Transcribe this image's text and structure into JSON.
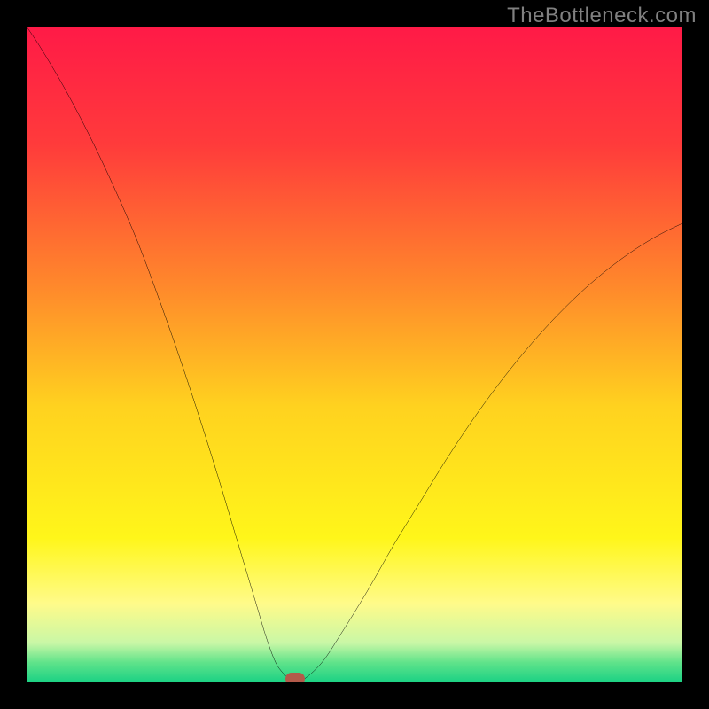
{
  "watermark": "TheBottleneck.com",
  "chart_data": {
    "type": "line",
    "title": "",
    "xlabel": "",
    "ylabel": "",
    "xlim": [
      0,
      100
    ],
    "ylim": [
      0,
      100
    ],
    "x": [
      0,
      2,
      5,
      8,
      11,
      14,
      17,
      20,
      23,
      26,
      29,
      32,
      35,
      36.5,
      38,
      39.5,
      40.5,
      42,
      45,
      48,
      52,
      56,
      60,
      64,
      68,
      72,
      76,
      80,
      84,
      88,
      92,
      96,
      100
    ],
    "values": [
      100,
      97,
      92,
      86.5,
      80.5,
      74,
      67,
      59,
      50.5,
      41.5,
      32,
      22,
      12,
      7,
      3,
      1,
      0.3,
      0.3,
      3,
      7.5,
      14,
      21,
      27.5,
      34,
      40,
      45.5,
      50.5,
      55,
      59,
      62.5,
      65.5,
      68,
      70
    ],
    "marker": {
      "x": 41,
      "y": 0.5
    },
    "background_gradient_stops": [
      {
        "offset": 0.0,
        "color": "#ff1a47"
      },
      {
        "offset": 0.18,
        "color": "#ff3b3b"
      },
      {
        "offset": 0.4,
        "color": "#ff8a2b"
      },
      {
        "offset": 0.58,
        "color": "#ffd21f"
      },
      {
        "offset": 0.78,
        "color": "#fff61a"
      },
      {
        "offset": 0.88,
        "color": "#fffb8a"
      },
      {
        "offset": 0.94,
        "color": "#c9f7a6"
      },
      {
        "offset": 0.97,
        "color": "#5fe38a"
      },
      {
        "offset": 1.0,
        "color": "#1ad184"
      }
    ]
  }
}
